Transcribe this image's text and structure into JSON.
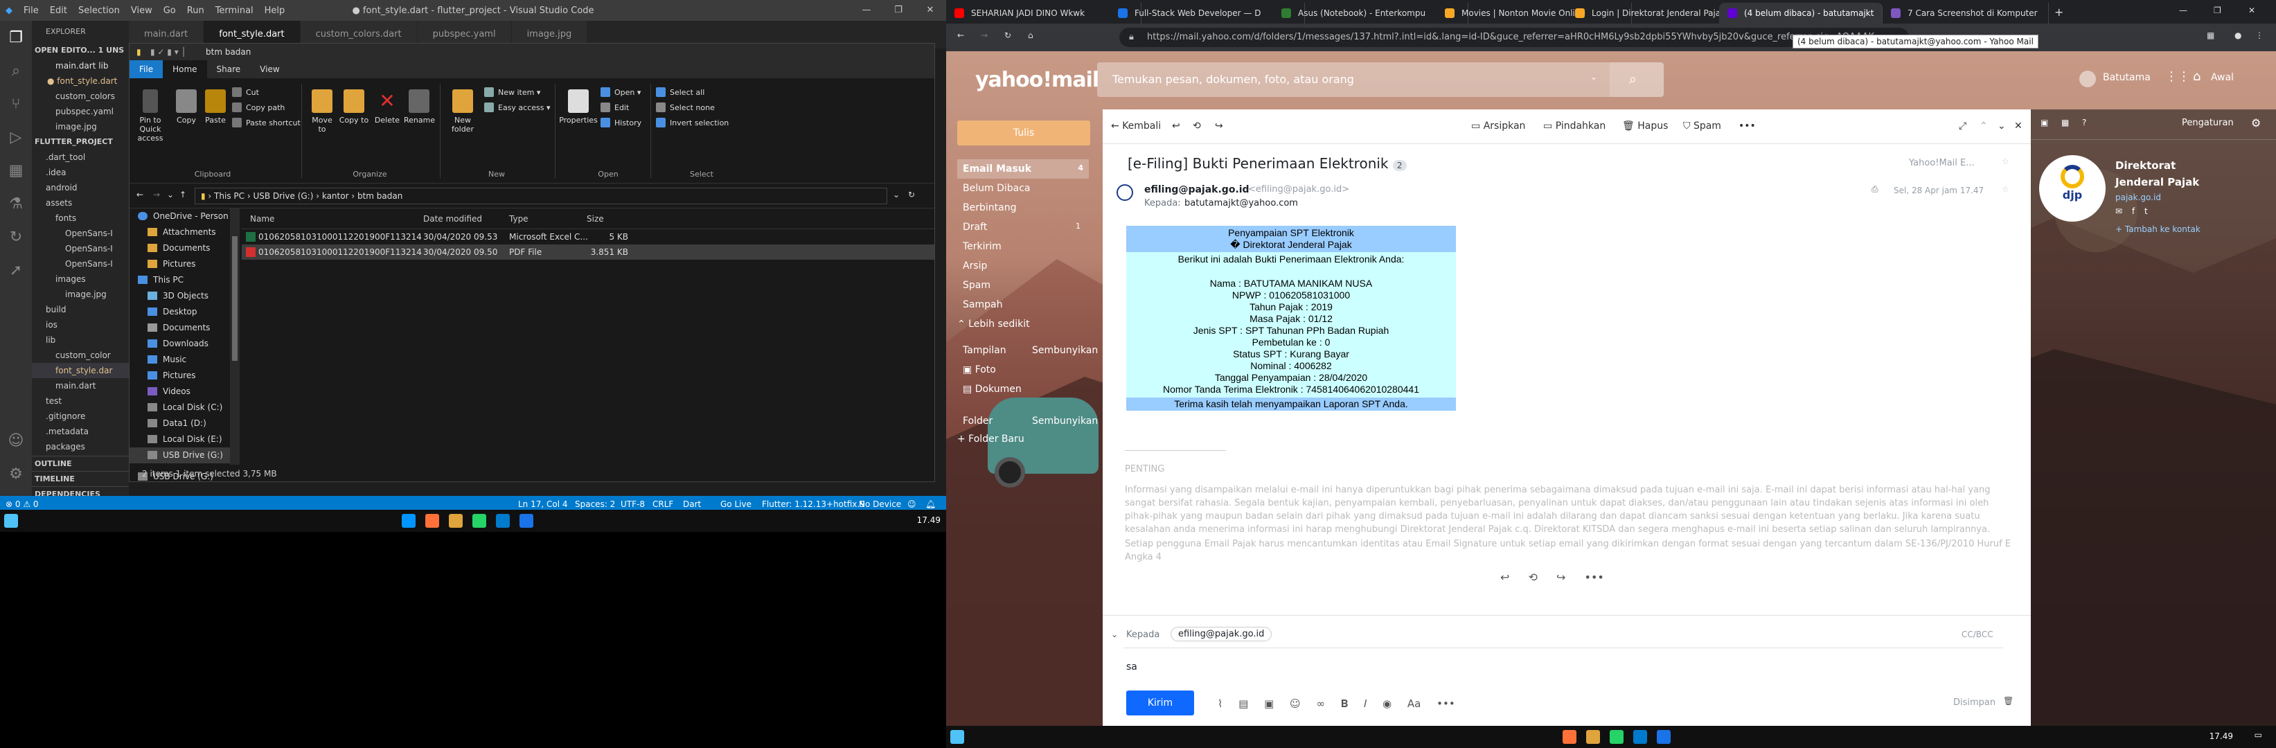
{
  "vscode": {
    "window_title": "● font_style.dart - flutter_project - Visual Studio Code",
    "menu": [
      "File",
      "Edit",
      "Selection",
      "View",
      "Go",
      "Run",
      "Terminal",
      "Help"
    ],
    "explorer_header": "EXPLORER",
    "open_editors": "OPEN EDITO...  1 UNS",
    "open_files": [
      "main.dart  lib",
      "● font_style.dart",
      "custom_colors",
      "pubspec.yaml",
      "image.jpg"
    ],
    "project": "FLUTTER_PROJECT",
    "tree": [
      ".dart_tool",
      ".idea",
      "android",
      "assets",
      "fonts",
      "OpenSans-I",
      "OpenSans-I",
      "OpenSans-I",
      "images",
      "image.jpg",
      "build",
      "ios",
      "lib",
      "custom_color",
      "font_style.dar",
      "main.dart",
      "test",
      ".gitignore",
      ".metadata",
      "packages"
    ],
    "outline": "OUTLINE",
    "timeline": "TIMELINE",
    "dependencies": "DEPENDENCIES",
    "tabs": [
      "main.dart",
      "font_style.dart",
      "custom_colors.dart",
      "pubspec.yaml",
      "image.jpg"
    ],
    "status": {
      "errors": "⊗ 0 ⚠ 0",
      "position": "Ln 17, Col 4",
      "spaces": "Spaces: 2",
      "encoding": "UTF-8",
      "eol": "CRLF",
      "language": "Dart",
      "golive": "Go Live",
      "flutter": "Flutter: 1.12.13+hotfix.9",
      "device": "No Device"
    }
  },
  "file_explorer": {
    "title": "btm badan",
    "ribbon_tabs": [
      "File",
      "Home",
      "Share",
      "View"
    ],
    "clipboard": {
      "pin": "Pin to Quick access",
      "copy": "Copy",
      "paste": "Paste",
      "cut": "Cut",
      "copy_path": "Copy path",
      "paste_shortcut": "Paste shortcut",
      "group": "Clipboard"
    },
    "organize": {
      "move": "Move to",
      "copy": "Copy to",
      "delete": "Delete",
      "rename": "Rename",
      "group": "Organize"
    },
    "new": {
      "folder": "New folder",
      "item": "New item",
      "easy_access": "Easy access",
      "group": "New"
    },
    "open": {
      "properties": "Properties",
      "open": "Open",
      "edit": "Edit",
      "history": "History",
      "group": "Open"
    },
    "select": {
      "all": "Select all",
      "none": "Select none",
      "invert": "Invert selection",
      "group": "Select"
    },
    "path": [
      "This PC",
      "USB Drive (G:)",
      "kantor",
      "btm badan"
    ],
    "nav": [
      "OneDrive - Person",
      "Attachments",
      "Documents",
      "Pictures",
      "This PC",
      "3D Objects",
      "Desktop",
      "Documents",
      "Downloads",
      "Music",
      "Pictures",
      "Videos",
      "Local Disk (C:)",
      "Data1 (D:)",
      "Local Disk (E:)",
      "USB Drive (G:)",
      "USB Drive (G:)"
    ],
    "columns": [
      "Name",
      "Date modified",
      "Type",
      "Size"
    ],
    "files": [
      {
        "name": "010620581031000112201900F11321401 1...",
        "date": "30/04/2020 09.53",
        "type": "Microsoft Excel C...",
        "size": "5 KB"
      },
      {
        "name": "010620581031000112201900F11321401 1...",
        "date": "30/04/2020 09.50",
        "type": "PDF File",
        "size": "3.851 KB"
      }
    ],
    "status": "2 items    1 item selected  3,75 MB"
  },
  "taskbar_left": {
    "clock": "17.49"
  },
  "chrome": {
    "tabs": [
      {
        "title": "SEHARIAN JADI DINO Wkwk",
        "color": "#ff0000"
      },
      {
        "title": "Full-Stack Web Developer — D",
        "color": "#1a73e8"
      },
      {
        "title": "Asus (Notebook) - Enterkompu",
        "color": "#2e7d32"
      },
      {
        "title": "Movies | Nonton Movie Online",
        "color": "#f9a825"
      },
      {
        "title": "Login | Direktorat Jenderal Paja",
        "color": "#f9a825"
      },
      {
        "title": "(4 belum dibaca) - batutamajkt",
        "color": "#6001d2"
      },
      {
        "title": "7 Cara Screenshot di Komputer",
        "color": "#7e57c2"
      }
    ],
    "url": "https://mail.yahoo.com/d/folders/1/messages/137.html?.intl=id&.lang=id-ID&guce_referrer=aHR0cHM6Ly9sb2dpbi55YWhvby5jb20v&guce_referrer_sig=AQAAAK",
    "tooltip": "(4 belum dibaca) - batutamajkt@yahoo.com - Yahoo Mail"
  },
  "yahoo": {
    "logo": "yahoo!mail",
    "search_placeholder": "Temukan pesan, dokumen, foto, atau orang",
    "user": "Batutama",
    "home": "Awal",
    "compose": "Tulis",
    "folders": [
      {
        "name": "Email Masuk",
        "count": "4"
      },
      {
        "name": "Belum Dibaca",
        "count": ""
      },
      {
        "name": "Berbintang",
        "count": ""
      },
      {
        "name": "Draft",
        "count": "1"
      },
      {
        "name": "Terkirim",
        "count": ""
      },
      {
        "name": "Arsip",
        "count": ""
      },
      {
        "name": "Spam",
        "count": ""
      },
      {
        "name": "Sampah",
        "count": ""
      }
    ],
    "less": "⌃ Lebih sedikit",
    "views": "Tampilan",
    "hide": "Sembunyikan",
    "photos": "Foto",
    "docs": "Dokumen",
    "folder_label": "Folder",
    "hide2": "Sembunyikan",
    "new_folder": "+ Folder Baru",
    "toolbar": {
      "back": "Kembali",
      "archive": "Arsipkan",
      "move": "Pindahkan",
      "delete": "Hapus",
      "spam": "Spam"
    },
    "subject": "[e-Filing] Bukti Penerimaan Elektronik",
    "thread_count": "2",
    "folder_tag": "Yahoo!Mail E...",
    "sender": "efiling@pajak.go.id",
    "sender_email": "<efiling@pajak.go.id>",
    "to_label": "Kepada:",
    "to": "batutamajkt@yahoo.com",
    "date": "Sel, 28 Apr jam 17.47",
    "spt": {
      "h1": "Penyampaian SPT Elektronik",
      "h2": "� Direktorat Jenderal Pajak",
      "intro": "Berikut ini adalah Bukti Penerimaan Elektronik Anda:",
      "lines": [
        "Nama : BATUTAMA MANIKAM NUSA",
        "NPWP : 010620581031000",
        "Tahun Pajak : 2019",
        "Masa Pajak : 01/12",
        "Jenis SPT : SPT Tahunan PPh Badan Rupiah",
        "Pembetulan ke : 0",
        "Status SPT : Kurang Bayar",
        "Nominal : 4006282",
        "Tanggal Penyampaian : 28/04/2020",
        "Nomor Tanda Terima Elektronik : 745814064062010280441"
      ],
      "thanks": "Terima kasih telah menyampaikan Laporan SPT Anda."
    },
    "penting_title": "PENTING",
    "penting_body": "Informasi yang disampaikan melalui e-mail ini hanya diperuntukkan bagi pihak penerima sebagaimana dimaksud pada tujuan e-mail ini saja. E-mail ini dapat berisi informasi atau hal-hal yang sangat bersifat rahasia. Segala bentuk kajian, penyampaian kembali, penyebarluasan, penyalinan untuk dapat diakses, dan/atau penggunaan lain atau tindakan sejenis atas informasi ini oleh pihak-pihak yang maupun badan selain dari pihak yang dimaksud pada tujuan e-mail ini adalah dilarang dan dapat diancam sanksi sesuai dengan ketentuan yang berlaku. Jika karena suatu kesalahan anda menerima informasi ini harap menghubungi Direktorat Jenderal Pajak c.q. Direktorat KITSDA dan segera menghapus e-mail ini beserta setiap salinan dan seluruh lampirannya.",
    "penting_note": "Setiap pengguna Email Pajak harus mencantumkan identitas atau Email Signature untuk setiap email yang dikirimkan dengan format sesuai dengan yang tercantum dalam SE-136/PJ/2010 Huruf E Angka 4",
    "reply": {
      "to_label": "Kepada",
      "to": "efiling@pajak.go.id",
      "cc": "CC/BCC",
      "body": "sa",
      "send": "Kirim",
      "discard": "Disimpan"
    },
    "settings": "Pengaturan",
    "contact": {
      "name1": "Direktorat",
      "name2": "Jenderal Pajak",
      "site": "pajak.go.id",
      "add": "+ Tambah ke kontak",
      "logo": "djp"
    }
  },
  "taskbar_right": {
    "clock": "17.49"
  }
}
